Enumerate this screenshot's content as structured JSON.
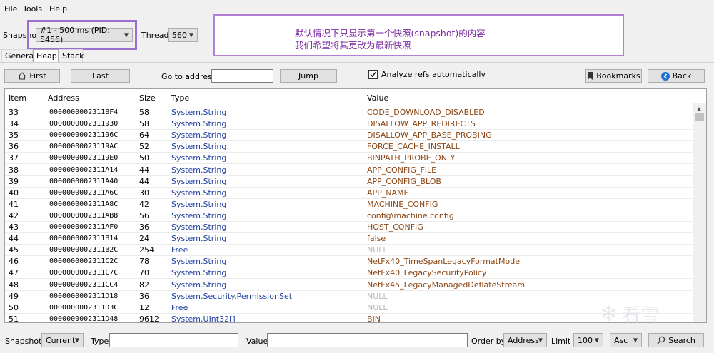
{
  "menu": [
    "File",
    "Tools",
    "Help"
  ],
  "toolbar": {
    "snapshot_label": "Snapshot",
    "snapshot_value": "#1 - 500 ms (PID: 5456)",
    "thread_label": "Thread",
    "thread_value": "560"
  },
  "annotation": {
    "line1": "默认情况下只显示第一个快照(snapshot)的内容",
    "line2": "我们希望将其更改为最新快照"
  },
  "tabs": [
    "General",
    "Heap",
    "Stack"
  ],
  "nav": {
    "first_label": "First",
    "last_label": "Last",
    "goto_label": "Go to address",
    "goto_value": "",
    "jump_label": "Jump",
    "analyze_label": "Analyze refs automatically",
    "analyze_checked": true,
    "bookmarks_label": "Bookmarks",
    "back_label": "Back"
  },
  "grid": {
    "headers": [
      "Item",
      "Address",
      "Size",
      "Type",
      "Value"
    ],
    "rows": [
      {
        "item": "33",
        "address": "00000000023118F4",
        "size": "58",
        "type": "System.String",
        "value": "CODE_DOWNLOAD_DISABLED",
        "null": false
      },
      {
        "item": "34",
        "address": "0000000002311930",
        "size": "58",
        "type": "System.String",
        "value": "DISALLOW_APP_REDIRECTS",
        "null": false
      },
      {
        "item": "35",
        "address": "000000000231196C",
        "size": "64",
        "type": "System.String",
        "value": "DISALLOW_APP_BASE_PROBING",
        "null": false
      },
      {
        "item": "36",
        "address": "00000000023119AC",
        "size": "52",
        "type": "System.String",
        "value": "FORCE_CACHE_INSTALL",
        "null": false
      },
      {
        "item": "37",
        "address": "00000000023119E0",
        "size": "50",
        "type": "System.String",
        "value": "BINPATH_PROBE_ONLY",
        "null": false
      },
      {
        "item": "38",
        "address": "0000000002311A14",
        "size": "44",
        "type": "System.String",
        "value": "APP_CONFIG_FILE",
        "null": false
      },
      {
        "item": "39",
        "address": "0000000002311A40",
        "size": "44",
        "type": "System.String",
        "value": "APP_CONFIG_BLOB",
        "null": false
      },
      {
        "item": "40",
        "address": "0000000002311A6C",
        "size": "30",
        "type": "System.String",
        "value": "APP_NAME",
        "null": false
      },
      {
        "item": "41",
        "address": "0000000002311A8C",
        "size": "42",
        "type": "System.String",
        "value": "MACHINE_CONFIG",
        "null": false
      },
      {
        "item": "42",
        "address": "0000000002311AB8",
        "size": "56",
        "type": "System.String",
        "value": "config\\machine.config",
        "null": false
      },
      {
        "item": "43",
        "address": "0000000002311AF0",
        "size": "36",
        "type": "System.String",
        "value": "HOST_CONFIG",
        "null": false
      },
      {
        "item": "44",
        "address": "0000000002311B14",
        "size": "24",
        "type": "System.String",
        "value": "false",
        "null": false
      },
      {
        "item": "45",
        "address": "0000000002311B2C",
        "size": "254",
        "type": "Free",
        "value": "NULL",
        "null": true
      },
      {
        "item": "46",
        "address": "0000000002311C2C",
        "size": "78",
        "type": "System.String",
        "value": "NetFx40_TimeSpanLegacyFormatMode",
        "null": false
      },
      {
        "item": "47",
        "address": "0000000002311C7C",
        "size": "70",
        "type": "System.String",
        "value": "NetFx40_LegacySecurityPolicy",
        "null": false
      },
      {
        "item": "48",
        "address": "0000000002311CC4",
        "size": "82",
        "type": "System.String",
        "value": "NetFx45_LegacyManagedDeflateStream",
        "null": false
      },
      {
        "item": "49",
        "address": "0000000002311D18",
        "size": "36",
        "type": "System.Security.PermissionSet",
        "value": "NULL",
        "null": true
      },
      {
        "item": "50",
        "address": "0000000002311D3C",
        "size": "12",
        "type": "Free",
        "value": "NULL",
        "null": true
      },
      {
        "item": "51",
        "address": "0000000002311D48",
        "size": "9612",
        "type": "System.UInt32[]",
        "value": "BIN",
        "null": false
      }
    ]
  },
  "filter": {
    "snapshot_label": "Snapshot",
    "snapshot_value": "Current",
    "type_label": "Type",
    "type_value": "",
    "value_label": "Value",
    "value_value": "",
    "orderby_label": "Order by",
    "orderby_value": "Address",
    "limit_label": "Limit",
    "limit_value": "100",
    "sort_value": "Asc",
    "search_label": "Search"
  },
  "watermark": "看雪",
  "colors": {
    "type_text": "#1f3f9f",
    "value_text": "#8b4513",
    "null_text": "#b8b8b8",
    "annotation_border": "#b27fd3",
    "annotation_text": "#7a2aa0"
  }
}
